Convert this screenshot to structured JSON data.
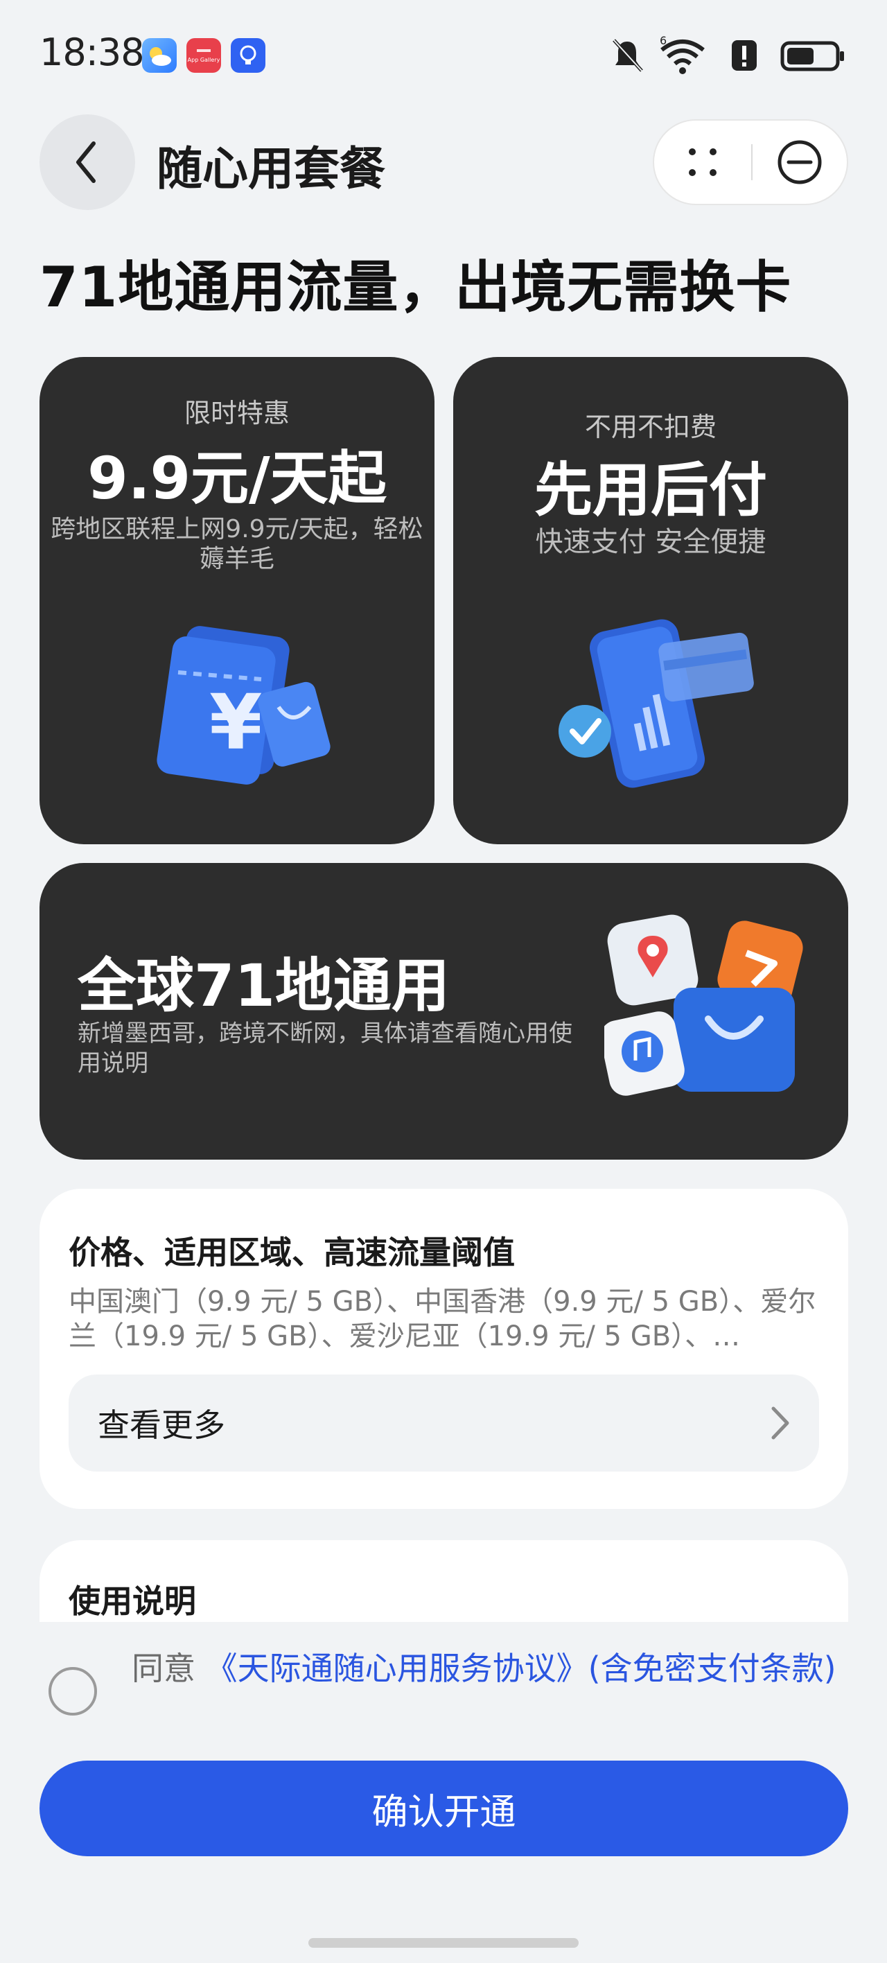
{
  "status_bar": {
    "time": "18:38",
    "signal_label": "6",
    "app_icons": [
      "weather-icon",
      "app-gallery-icon",
      "tips-icon"
    ],
    "app_gallery_label": "App Gallery"
  },
  "header": {
    "title": "随心用套餐",
    "back_icon": "chevron-left-icon",
    "more_icon": "more-dots-icon",
    "close_icon": "minus-circle-icon"
  },
  "headline": "71地通用流量，出境无需换卡",
  "cards": {
    "promo": {
      "tag": "限时特惠",
      "title": "9.9元/天起",
      "desc": "跨地区联程上网9.9元/天起，轻松薅羊毛"
    },
    "pay_later": {
      "tag": "不用不扣费",
      "title": "先用后付",
      "desc": "快速支付 安全便捷"
    },
    "global": {
      "title": "全球71地通用",
      "desc": "新增墨西哥，跨境不断网，具体请查看随心用使用说明"
    }
  },
  "price_section": {
    "title": "价格、适用区域、高速流量阈值",
    "body": "中国澳门（9.9 元/ 5 GB）、中国香港（9.9 元/ 5 GB）、爱尔兰（19.9 元/ 5 GB）、爱沙尼亚（19.9 元/ 5 GB）、…",
    "view_more": "查看更多"
  },
  "usage_section": {
    "title": "使用说明"
  },
  "agreement": {
    "prefix": "同意 ",
    "link": "《天际通随心用服务协议》(含免密支付条款)"
  },
  "confirm_button": "确认开通",
  "colors": {
    "primary": "#2a5ae6",
    "card_dark": "#2d2d2d",
    "background": "#f1f3f5"
  }
}
